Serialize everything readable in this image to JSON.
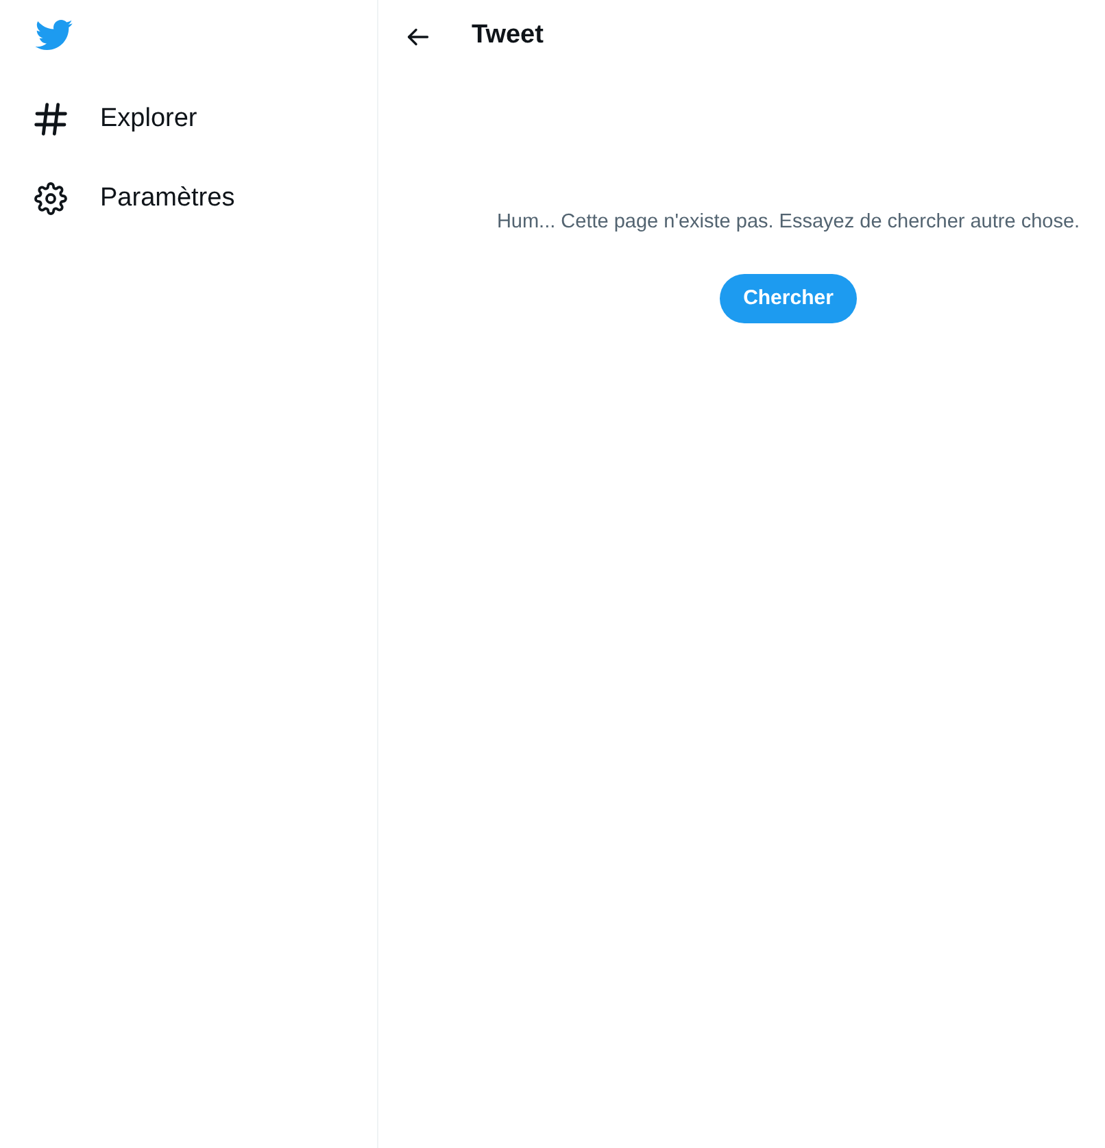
{
  "sidebar": {
    "items": [
      {
        "label": "Explorer",
        "kind": "hashtag"
      },
      {
        "label": "Paramètres",
        "kind": "settings"
      }
    ]
  },
  "header": {
    "title": "Tweet"
  },
  "empty_state": {
    "message": "Hum... Cette page n'existe pas. Essayez de chercher autre chose.",
    "button": "Chercher"
  }
}
